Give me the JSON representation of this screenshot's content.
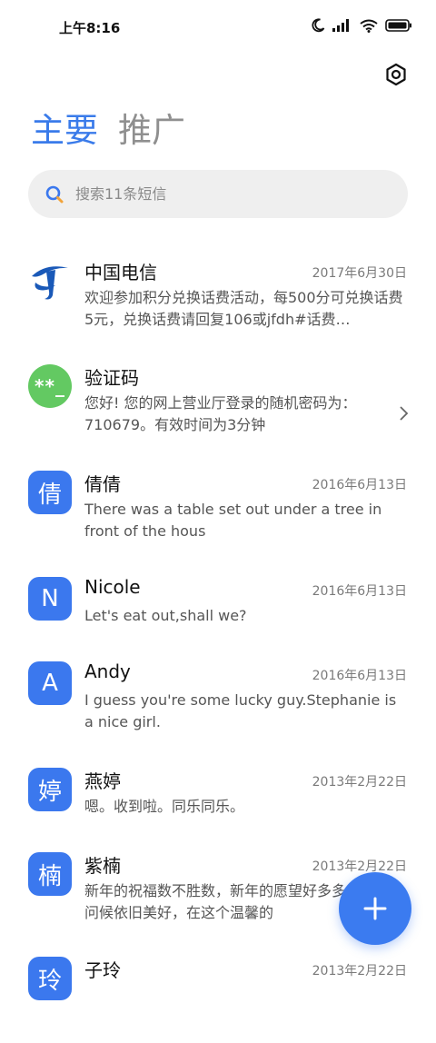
{
  "status_bar": {
    "time": "上午8:16"
  },
  "tabs": [
    {
      "label": "主要",
      "active": true
    },
    {
      "label": "推广",
      "active": false
    }
  ],
  "search": {
    "placeholder": "搜索11条短信"
  },
  "conversations": [
    {
      "name": "中国电信",
      "date": "2017年6月30日",
      "preview": "欢迎参加积分兑换话费活动，每500分可兑换话费5元，兑换话费请回复106或jfdh#话费…",
      "avatar": "logo"
    },
    {
      "name": "验证码",
      "date": "",
      "preview": "您好! 您的网上营业厅登录的随机密码为：710679。有效时间为3分钟",
      "avatar_text": "**_"
    },
    {
      "name": "倩倩",
      "date": "2016年6月13日",
      "preview": "There was a table set out under a tree in front of the hous",
      "avatar_text": "倩"
    },
    {
      "name": "Nicole",
      "date": "2016年6月13日",
      "preview": "Let's eat out,shall we?",
      "avatar_text": "N"
    },
    {
      "name": "Andy",
      "date": "2016年6月13日",
      "preview": "I guess you're some lucky guy.Stephanie is a nice girl.",
      "avatar_text": "A"
    },
    {
      "name": "燕婷",
      "date": "2013年2月22日",
      "preview": "嗯。收到啦。同乐同乐。",
      "avatar_text": "婷"
    },
    {
      "name": "紫楠",
      "date": "2013年2月22日",
      "preview": "新年的祝福数不胜数，新年的愿望好多多，新年的问候依旧美好，在这个温馨的",
      "avatar_text": "楠"
    },
    {
      "name": "子玲",
      "date": "2013年2月22日",
      "preview": "",
      "avatar_text": "玲"
    }
  ],
  "colors": {
    "accent": "#3a7bea",
    "avatar_blue": "#3b78ee",
    "avatar_green": "#63c962"
  }
}
